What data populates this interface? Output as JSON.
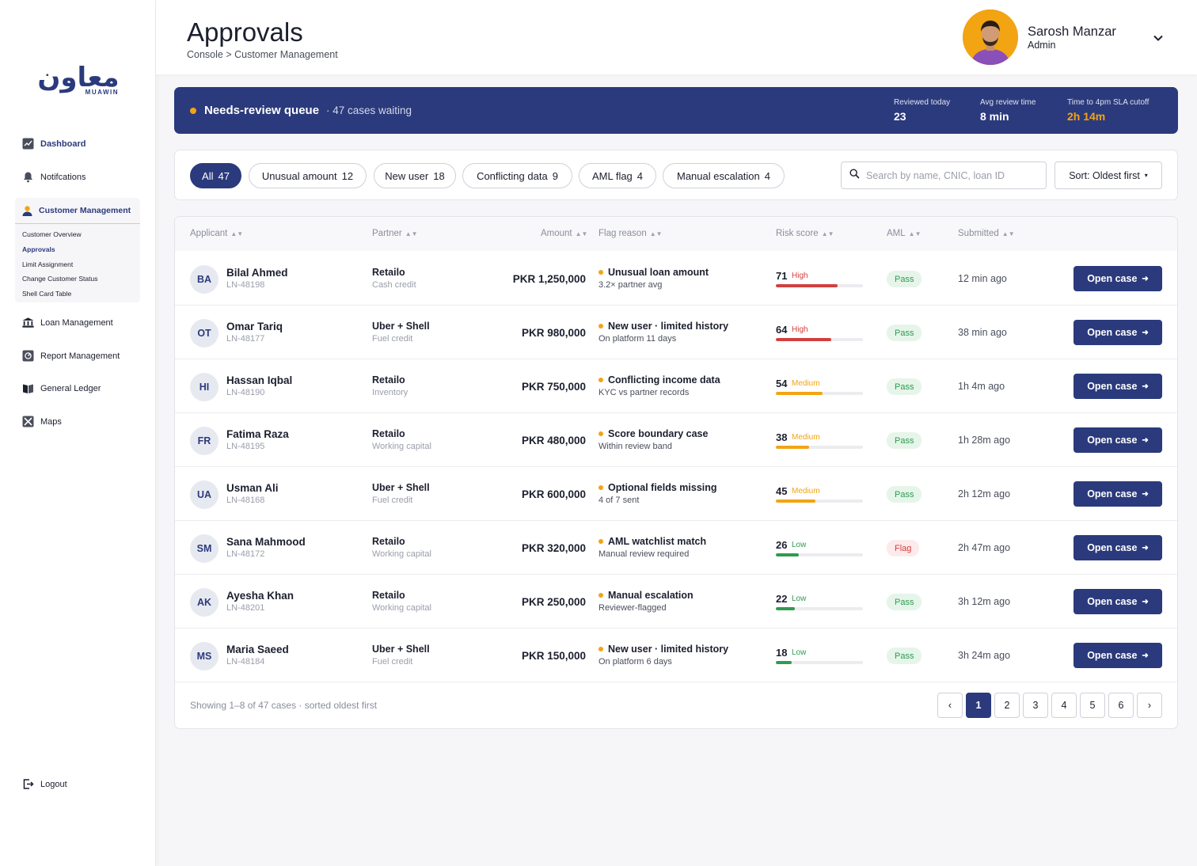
{
  "brand": {
    "logo_text": "معاون",
    "logo_sub": "MUAWIN",
    "accent": "#2b3a7c",
    "amber": "#f2a413"
  },
  "sidebar": {
    "items": [
      {
        "label": "Dashboard",
        "icon": "chart-icon"
      },
      {
        "label": "Notifcations",
        "icon": "bell-icon"
      },
      {
        "label": "Customer Management",
        "icon": "user-icon"
      },
      {
        "label": "Loan Management",
        "icon": "bank-icon"
      },
      {
        "label": "Report Management",
        "icon": "report-icon"
      },
      {
        "label": "General Ledger",
        "icon": "ledger-icon"
      },
      {
        "label": "Maps",
        "icon": "map-icon"
      }
    ],
    "sub_items": [
      {
        "label": "Customer Overview"
      },
      {
        "label": "Approvals"
      },
      {
        "label": "Limit Assignment"
      },
      {
        "label": "Change Customer Status"
      },
      {
        "label": "Shell Card Table"
      }
    ],
    "logout": "Logout"
  },
  "header": {
    "title": "Approvals",
    "breadcrumb": "Console > Customer Management",
    "user_name": "Sarosh Manzar",
    "user_role": "Admin"
  },
  "banner": {
    "title": "Needs-review queue",
    "count": "· 47 cases waiting",
    "stats": [
      {
        "label": "Reviewed today",
        "value": "23"
      },
      {
        "label": "Avg review time",
        "value": "8 min"
      },
      {
        "label": "Time to 4pm SLA cutoff",
        "value": "2h 14m"
      }
    ]
  },
  "filters": {
    "chips": [
      {
        "label": "All",
        "count": "47"
      },
      {
        "label": "Unusual amount",
        "count": "12"
      },
      {
        "label": "New user",
        "count": "18"
      },
      {
        "label": "Conflicting data",
        "count": "9"
      },
      {
        "label": "AML flag",
        "count": "4"
      },
      {
        "label": "Manual escalation",
        "count": "4"
      }
    ],
    "search_placeholder": "Search by name, CNIC, loan ID",
    "sort_label": "Sort: Oldest first"
  },
  "table": {
    "headers": [
      "Applicant",
      "Partner",
      "Amount",
      "Flag reason",
      "Risk score",
      "AML",
      "Submitted"
    ],
    "open_label": "Open case",
    "rows": [
      {
        "initials": "BA",
        "name": "Bilal Ahmed",
        "id": "LN-48198",
        "partner": "Retailo",
        "product": "Cash credit",
        "amount": "PKR 1,250,000",
        "flag": "Unusual loan amount",
        "flag_sub": "3.2× partner avg",
        "risk": 71,
        "risk_level": "High",
        "aml": "Pass",
        "submitted": "12 min ago"
      },
      {
        "initials": "OT",
        "name": "Omar Tariq",
        "id": "LN-48177",
        "partner": "Uber + Shell",
        "product": "Fuel credit",
        "amount": "PKR 980,000",
        "flag": "New user · limited history",
        "flag_sub": "On platform 11 days",
        "risk": 64,
        "risk_level": "High",
        "aml": "Pass",
        "submitted": "38 min ago"
      },
      {
        "initials": "HI",
        "name": "Hassan Iqbal",
        "id": "LN-48190",
        "partner": "Retailo",
        "product": "Inventory",
        "amount": "PKR 750,000",
        "flag": "Conflicting income data",
        "flag_sub": "KYC vs partner records",
        "risk": 54,
        "risk_level": "Medium",
        "aml": "Pass",
        "submitted": "1h 4m ago"
      },
      {
        "initials": "FR",
        "name": "Fatima Raza",
        "id": "LN-48195",
        "partner": "Retailo",
        "product": "Working capital",
        "amount": "PKR 480,000",
        "flag": "Score boundary case",
        "flag_sub": "Within review band",
        "risk": 38,
        "risk_level": "Medium",
        "aml": "Pass",
        "submitted": "1h 28m ago"
      },
      {
        "initials": "UA",
        "name": "Usman Ali",
        "id": "LN-48168",
        "partner": "Uber + Shell",
        "product": "Fuel credit",
        "amount": "PKR 600,000",
        "flag": "Optional fields missing",
        "flag_sub": "4 of 7 sent",
        "risk": 45,
        "risk_level": "Medium",
        "aml": "Pass",
        "submitted": "2h 12m ago"
      },
      {
        "initials": "SM",
        "name": "Sana Mahmood",
        "id": "LN-48172",
        "partner": "Retailo",
        "product": "Working capital",
        "amount": "PKR 320,000",
        "flag": "AML watchlist match",
        "flag_sub": "Manual review required",
        "risk": 26,
        "risk_level": "Low",
        "aml": "Flag",
        "submitted": "2h 47m ago"
      },
      {
        "initials": "AK",
        "name": "Ayesha Khan",
        "id": "LN-48201",
        "partner": "Retailo",
        "product": "Working capital",
        "amount": "PKR 250,000",
        "flag": "Manual escalation",
        "flag_sub": "Reviewer-flagged",
        "risk": 22,
        "risk_level": "Low",
        "aml": "Pass",
        "submitted": "3h 12m ago"
      },
      {
        "initials": "MS",
        "name": "Maria Saeed",
        "id": "LN-48184",
        "partner": "Uber + Shell",
        "product": "Fuel credit",
        "amount": "PKR 150,000",
        "flag": "New user · limited history",
        "flag_sub": "On platform 6 days",
        "risk": 18,
        "risk_level": "Low",
        "aml": "Pass",
        "submitted": "3h 24m ago"
      }
    ]
  },
  "risk_colors": {
    "High": "#d23f3f",
    "Medium": "#f2a413",
    "Low": "#2f9a52"
  },
  "footer": {
    "showing": "Showing 1–8 of 47 cases · sorted oldest first",
    "prev": "‹",
    "next": "›",
    "pages": [
      "1",
      "2",
      "3",
      "4",
      "5",
      "6"
    ],
    "current_page": "1"
  }
}
